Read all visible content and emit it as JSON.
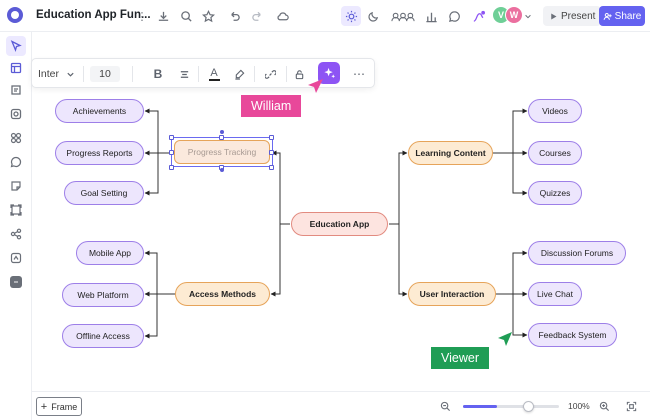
{
  "app": {
    "doc_title": "Education App Fun...",
    "present_label": "Present",
    "share_label": "Share",
    "avatars": [
      {
        "initial": "V",
        "color": "#6fcf97"
      },
      {
        "initial": "W",
        "color": "#eb6f9f"
      }
    ]
  },
  "format_toolbar": {
    "font_family": "Inter",
    "font_size": "10"
  },
  "mindmap": {
    "root": "Education App",
    "branches": [
      {
        "label": "Learning Content",
        "children": [
          "Videos",
          "Courses",
          "Quizzes"
        ]
      },
      {
        "label": "User Interaction",
        "children": [
          "Discussion Forums",
          "Live Chat",
          "Feedback System"
        ]
      },
      {
        "label": "Progress Tracking",
        "children": [
          "Achievements",
          "Progress Reports",
          "Goal Setting"
        ]
      },
      {
        "label": "Access Methods",
        "children": [
          "Mobile App",
          "Web Platform",
          "Offline Access"
        ]
      }
    ]
  },
  "cursors": [
    {
      "name": "William",
      "color": "#e8489a"
    },
    {
      "name": "Viewer",
      "color": "#1f9d55"
    }
  ],
  "bottom": {
    "frame_label": "Frame",
    "zoom_level": "100%",
    "zoom_fraction": 0.35
  }
}
